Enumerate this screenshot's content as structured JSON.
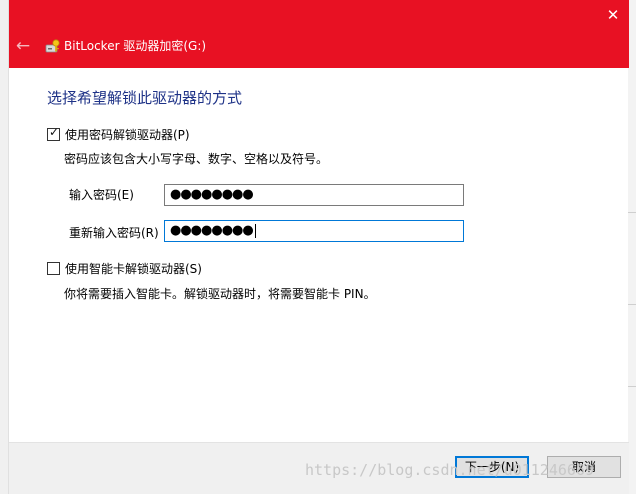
{
  "window": {
    "title": "BitLocker 驱动器加密(G:)",
    "back_icon": "back-arrow-icon",
    "close_symbol": "✕",
    "accent_color": "#e81123"
  },
  "main": {
    "heading": "选择希望解锁此驱动器的方式",
    "password_option": {
      "label": "使用密码解锁驱动器(P)",
      "checked": true,
      "hint": "密码应该包含大小写字母、数字、空格以及符号。",
      "enter_label": "输入密码(E)",
      "enter_value": "●●●●●●●●",
      "reenter_label": "重新输入密码(R)",
      "reenter_value": "●●●●●●●●"
    },
    "smartcard_option": {
      "label": "使用智能卡解锁驱动器(S)",
      "checked": false,
      "hint": "你将需要插入智能卡。解锁驱动器时，将需要智能卡 PIN。"
    }
  },
  "footer": {
    "next_label": "下一步(N)",
    "cancel_label": "取消"
  },
  "watermark": "https://blog.csdn.net/u011246669"
}
